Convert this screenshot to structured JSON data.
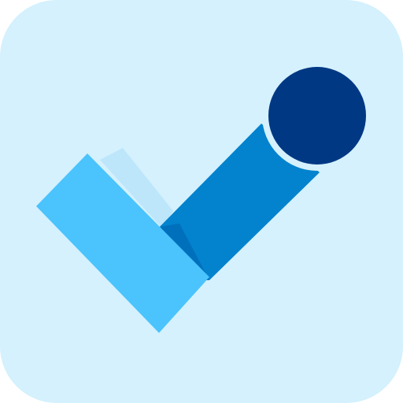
{
  "icon": {
    "name": "checkmark-icon",
    "colors": {
      "background": "#D4F1FD",
      "short_stroke": "#4BC3FD",
      "short_stroke_shadow": "#BDE6FB",
      "long_stroke": "#0382CE",
      "long_stroke_shade": "#0070BC",
      "dot": "#003884",
      "dot_outline": "#D4F1FD"
    }
  }
}
